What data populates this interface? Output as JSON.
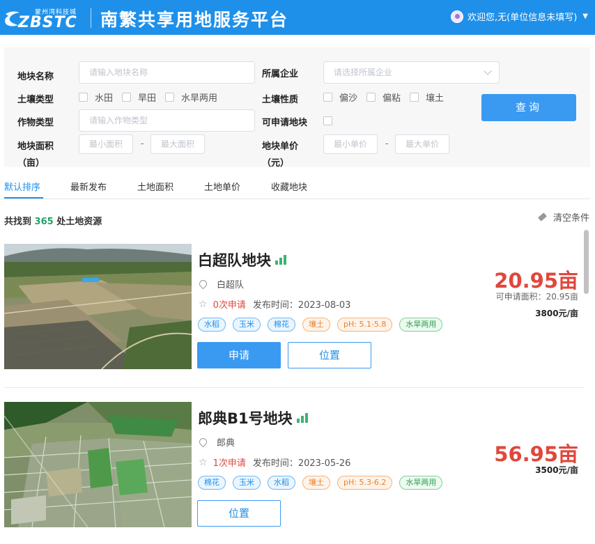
{
  "header": {
    "logo_sub": "蒙州湾科技城",
    "logo_main": "ZBSTC",
    "platform_title": "南繁共享用地服务平台",
    "user_greeting": "欢迎您,无(单位信息未填写)"
  },
  "filter": {
    "plot_name_label": "地块名称",
    "plot_name_placeholder": "请输入地块名称",
    "company_label": "所属企业",
    "company_placeholder": "请选择所属企业",
    "soil_type_label": "土壤类型",
    "soil_types": [
      "水田",
      "旱田",
      "水旱两用"
    ],
    "soil_nature_label": "土壤性质",
    "soil_natures": [
      "偏沙",
      "偏粘",
      "壤土"
    ],
    "crop_label": "作物类型",
    "crop_placeholder": "请输入作物类型",
    "applicable_label": "可申请地块",
    "area_label_1": "地块面积",
    "area_label_2": "（亩）",
    "area_min_placeholder": "最小面积",
    "area_max_placeholder": "最大面积",
    "price_label_1": "地块单价",
    "price_label_2": "（元）",
    "price_min_placeholder": "最小单价",
    "price_max_placeholder": "最大单价",
    "range_dash": "-",
    "query_button": "查询"
  },
  "tabs": [
    "默认排序",
    "最新发布",
    "土地面积",
    "土地单价",
    "收藏地块"
  ],
  "results": {
    "prefix": "共找到",
    "count": "365",
    "suffix": "处土地资源",
    "clear_label": "清空条件"
  },
  "plots": [
    {
      "name": "白超队地块",
      "location": "白超队",
      "apply_count": "0次申请",
      "publish_time": "发布时间：2023-08-03",
      "tags": [
        {
          "text": "水稻",
          "color": "blue"
        },
        {
          "text": "玉米",
          "color": "blue"
        },
        {
          "text": "棉花",
          "color": "blue"
        },
        {
          "text": "壤土",
          "color": "orange"
        },
        {
          "text": "pH: 5.1-5.8",
          "color": "orange"
        },
        {
          "text": "水旱两用",
          "color": "green"
        }
      ],
      "area": "20.95亩",
      "available_area": "可申请面积：20.95亩",
      "unit_price": "3800元/亩",
      "apply_button": "申请",
      "location_button": "位置"
    },
    {
      "name": "郎典B1号地块",
      "location": "郎典",
      "apply_count": "1次申请",
      "publish_time": "发布时间：2023-05-26",
      "tags": [
        {
          "text": "棉花",
          "color": "blue"
        },
        {
          "text": "玉米",
          "color": "blue"
        },
        {
          "text": "水稻",
          "color": "blue"
        },
        {
          "text": "壤土",
          "color": "orange"
        },
        {
          "text": "pH: 5.3-6.2",
          "color": "orange"
        },
        {
          "text": "水旱两用",
          "color": "green"
        }
      ],
      "area": "56.95亩",
      "unit_price": "3500元/亩",
      "location_button": "位置"
    }
  ],
  "colors": {
    "header_blue": "#1e90ea",
    "button_blue": "#3a9af2",
    "price_red": "#e0473c",
    "count_green": "#21a366"
  }
}
